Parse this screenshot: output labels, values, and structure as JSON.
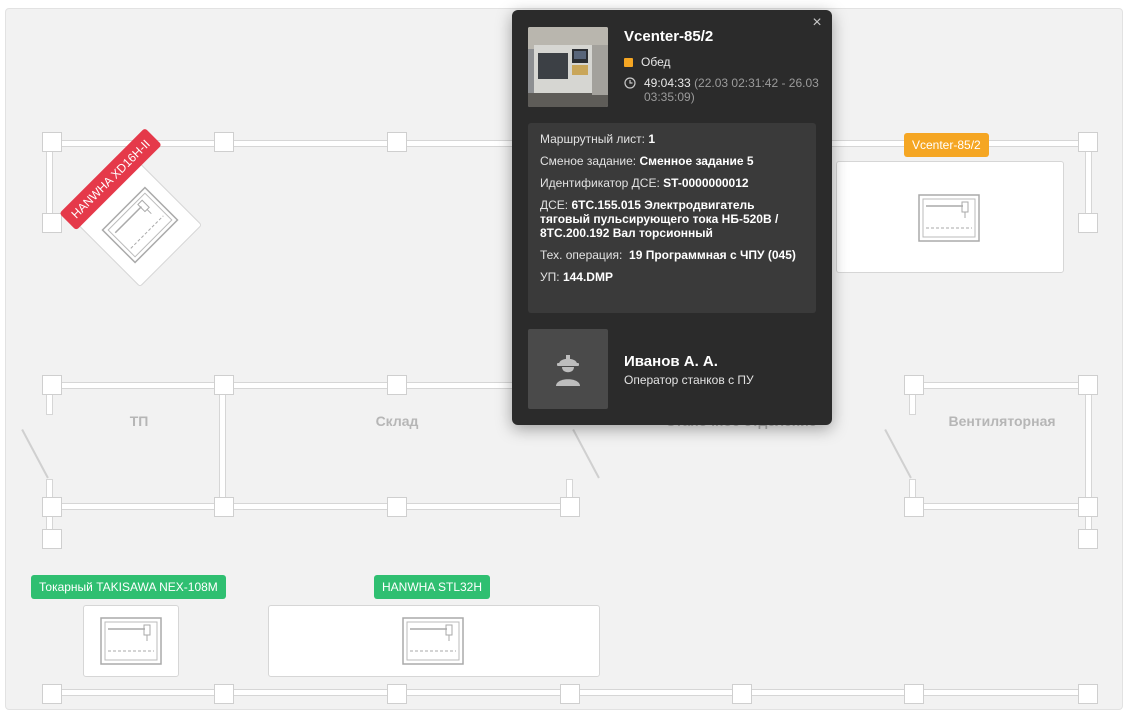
{
  "rooms": {
    "tp": "ТП",
    "sklad": "Склад",
    "hidden": "Станочное отделение",
    "vent": "Вентиляторная"
  },
  "machines": {
    "hanwha_xd": {
      "label": "HANWHA XD16H-II",
      "status_color": "#e5394a"
    },
    "vcenter": {
      "label": "Vcenter-85/2",
      "status_color": "#f5a623"
    },
    "takisawa": {
      "label": "Токарный TAKISAWA NEX-108M",
      "status_color": "#2fbf71"
    },
    "hanwha_stl": {
      "label": "HANWHA STL32H",
      "status_color": "#2fbf71"
    }
  },
  "popup": {
    "close": "×",
    "title": "Vcenter-85/2",
    "status": "Обед",
    "status_color": "#f5a623",
    "duration": "49:04:33",
    "range": "(22.03 02:31:42 - 26.03 03:35:09)",
    "info": {
      "route_label": "Маршрутный лист:",
      "route_value": "1",
      "shift_label": "Сменое задание:",
      "shift_value": "Сменное задание 5",
      "dse_id_label": "Идентификатор ДСЕ:",
      "dse_id_value": "ST-0000000012",
      "dse_label": "ДСЕ:",
      "dse_value": "6ТС.155.015 Электродвигатель тяговый пульсирующего тока НБ-520В / 8ТС.200.192 Вал торсионный",
      "op_label": "Тех. операция:",
      "op_value": "19 Программная с ЧПУ (045)",
      "up_label": "УП:",
      "up_value": "144.DMP"
    },
    "operator": {
      "name": "Иванов А. А.",
      "role": "Оператор станков с ПУ"
    }
  }
}
